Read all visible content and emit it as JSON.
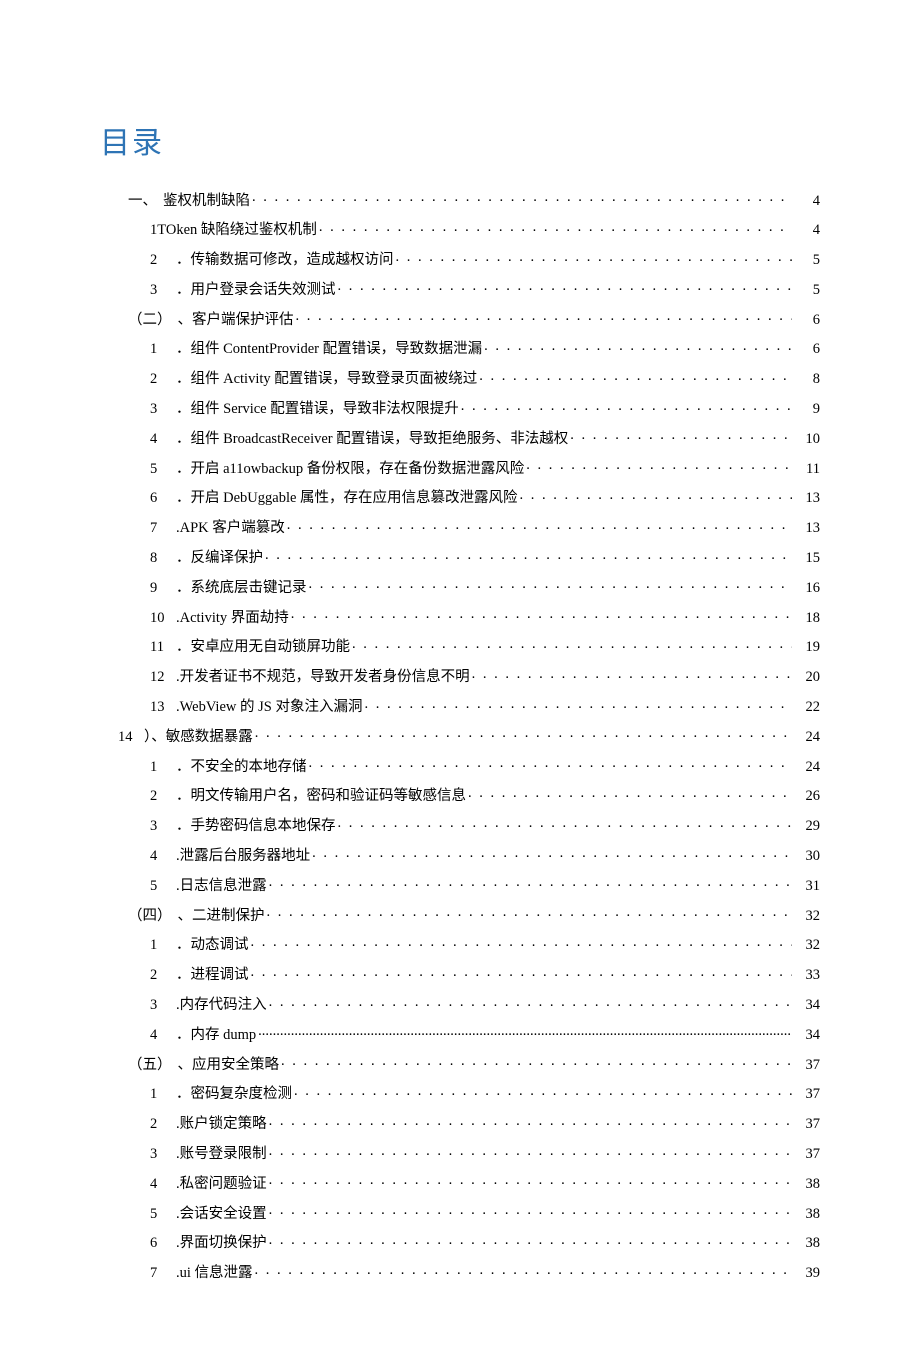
{
  "title": "目录",
  "entries": [
    {
      "indent": "lv1",
      "num": "一、",
      "label": "鉴权机制缺陷",
      "page": "4",
      "leader": "dots"
    },
    {
      "indent": "lv2",
      "num": "",
      "label": "1TOken 缺陷绕过鉴权机制",
      "page": "4",
      "leader": "dots"
    },
    {
      "indent": "lv2",
      "num": "2",
      "label": "．传输数据可修改，造成越权访问",
      "page": "5",
      "leader": "dots"
    },
    {
      "indent": "lv2",
      "num": "3",
      "label": "．用户登录会话失效测试",
      "page": "5",
      "leader": "dots"
    },
    {
      "indent": "lv1",
      "num": "（二）",
      "label": "、客户端保护评估",
      "page": "6",
      "leader": "dots"
    },
    {
      "indent": "lv2",
      "num": "1",
      "label": "．组件 ContentProvider 配置错误，导致数据泄漏",
      "page": "6",
      "leader": "dots"
    },
    {
      "indent": "lv2",
      "num": "2",
      "label": "．组件 Activity 配置错误，导致登录页面被绕过",
      "page": "8",
      "leader": "dots"
    },
    {
      "indent": "lv2",
      "num": "3",
      "label": "．组件 Service 配置错误，导致非法权限提升",
      "page": "9",
      "leader": "dots"
    },
    {
      "indent": "lv2",
      "num": "4",
      "label": "．组件 BroadcastReceiver 配置错误，导致拒绝服务、非法越权",
      "page": "10",
      "leader": "dots"
    },
    {
      "indent": "lv2",
      "num": "5",
      "label": "．开启 a11owbackup 备份权限，存在备份数据泄露风险",
      "page": "11",
      "leader": "dots"
    },
    {
      "indent": "lv2",
      "num": "6",
      "label": "．开启 DebUggable 属性，存在应用信息篡改泄露风险",
      "page": "13",
      "leader": "dots"
    },
    {
      "indent": "lv2",
      "num": "7",
      "label": ".APK 客户端篡改",
      "page": "13",
      "leader": "dots"
    },
    {
      "indent": "lv2",
      "num": "8",
      "label": "．反编译保护",
      "page": "15",
      "leader": "dots"
    },
    {
      "indent": "lv2",
      "num": "9",
      "label": "．系统底层击键记录",
      "page": "16",
      "leader": "dots"
    },
    {
      "indent": "lv2",
      "num": "10",
      "label": ".Activity 界面劫持",
      "page": "18",
      "leader": "dots"
    },
    {
      "indent": "lv2",
      "num": "11",
      "label": "．安卓应用无自动锁屏功能",
      "page": "19",
      "leader": "dots"
    },
    {
      "indent": "lv2",
      "num": "12",
      "label": ".开发者证书不规范，导致开发者身份信息不明",
      "page": "20",
      "leader": "dots"
    },
    {
      "indent": "lv2",
      "num": "13",
      "label": ".WebView 的 JS 对象注入漏洞",
      "page": "22",
      "leader": "dots"
    },
    {
      "indent": "lv3",
      "num": "14",
      "label": "）、敏感数据暴露",
      "page": "24",
      "leader": "dots"
    },
    {
      "indent": "lv2",
      "num": "1",
      "label": "．不安全的本地存储",
      "page": "24",
      "leader": "dots"
    },
    {
      "indent": "lv2",
      "num": "2",
      "label": "．明文传输用户名，密码和验证码等敏感信息",
      "page": "26",
      "leader": "dots"
    },
    {
      "indent": "lv2",
      "num": "3",
      "label": "．手势密码信息本地保存",
      "page": "29",
      "leader": "dots"
    },
    {
      "indent": "lv2",
      "num": "4",
      "label": ".泄露后台服务器地址",
      "page": "30",
      "leader": "dots"
    },
    {
      "indent": "lv2",
      "num": "5",
      "label": ".日志信息泄露",
      "page": "31",
      "leader": "dots"
    },
    {
      "indent": "lv1",
      "num": "（四）",
      "label": "、二进制保护",
      "page": "32",
      "leader": "dots"
    },
    {
      "indent": "lv2",
      "num": "1",
      "label": "．动态调试",
      "page": "32",
      "leader": "dots"
    },
    {
      "indent": "lv2",
      "num": "2",
      "label": "．进程调试",
      "page": "33",
      "leader": "dots"
    },
    {
      "indent": "lv2",
      "num": "3",
      "label": ".内存代码注入",
      "page": "34",
      "leader": "dots"
    },
    {
      "indent": "lv2",
      "num": "4",
      "label": "．内存 dump",
      "page": "34",
      "leader": "dense"
    },
    {
      "indent": "lv1",
      "num": "（五）",
      "label": "、应用安全策略",
      "page": "37",
      "leader": "dots"
    },
    {
      "indent": "lv2",
      "num": "1",
      "label": "．密码复杂度检测",
      "page": "37",
      "leader": "dots"
    },
    {
      "indent": "lv2",
      "num": "2",
      "label": ".账户锁定策略",
      "page": "37",
      "leader": "dots"
    },
    {
      "indent": "lv2",
      "num": "3",
      "label": ".账号登录限制",
      "page": "37",
      "leader": "dots"
    },
    {
      "indent": "lv2",
      "num": "4",
      "label": ".私密问题验证",
      "page": "38",
      "leader": "dots"
    },
    {
      "indent": "lv2",
      "num": "5",
      "label": ".会话安全设置",
      "page": "38",
      "leader": "dots"
    },
    {
      "indent": "lv2",
      "num": "6",
      "label": ".界面切换保护",
      "page": "38",
      "leader": "dots"
    },
    {
      "indent": "lv2",
      "num": "7",
      "label": ".ui 信息泄露",
      "page": "39",
      "leader": "dots"
    }
  ]
}
